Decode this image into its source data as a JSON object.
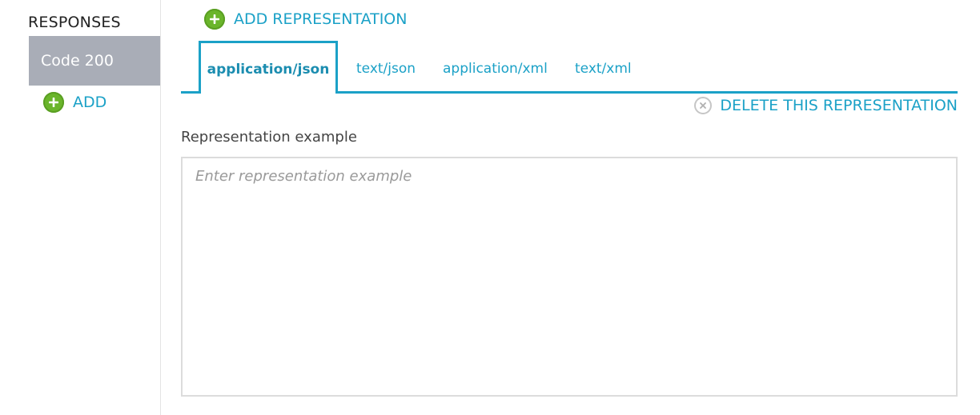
{
  "sidebar": {
    "title": "RESPONSES",
    "items": [
      {
        "label": "Code 200"
      }
    ],
    "add_label": "ADD"
  },
  "main": {
    "add_representation_label": "ADD REPRESENTATION",
    "tabs": [
      {
        "label": "application/json",
        "active": true
      },
      {
        "label": "text/json"
      },
      {
        "label": "application/xml"
      },
      {
        "label": "text/xml"
      }
    ],
    "delete_label": "DELETE THIS REPRESENTATION",
    "field_label": "Representation example",
    "example": {
      "value": "",
      "placeholder": "Enter representation example"
    }
  },
  "colors": {
    "accent": "#1ba1c7",
    "add_icon": "#6ab52b",
    "selected_item_bg": "#a9adb7"
  },
  "icons": {
    "add": "plus-circle-icon",
    "delete": "close-circle-icon"
  }
}
